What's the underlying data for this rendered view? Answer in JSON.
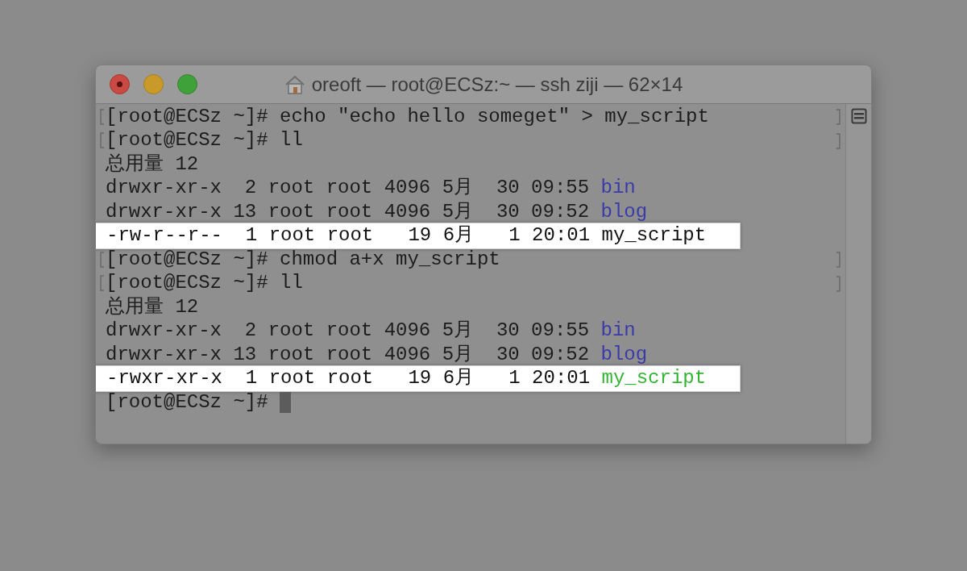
{
  "window": {
    "title": "oreoft — root@ECSz:~ — ssh ziji — 62×14"
  },
  "lines": [
    {
      "kind": "prompt",
      "marked": true,
      "prompt": "[root@ECSz ~]#",
      "command": "echo \"echo hello someget\" > my_script"
    },
    {
      "kind": "prompt",
      "marked": true,
      "prompt": "[root@ECSz ~]#",
      "command": "ll"
    },
    {
      "kind": "output",
      "marked": false,
      "text": "总用量 12"
    },
    {
      "kind": "listing",
      "highlighted": false,
      "text": "drwxr-xr-x  2 root root 4096 5月  30 09:55",
      "file": "bin",
      "color": "#3a3aa8"
    },
    {
      "kind": "listing",
      "highlighted": false,
      "text": "drwxr-xr-x 13 root root 4096 5月  30 09:52",
      "file": "blog",
      "color": "#3a3aa8"
    },
    {
      "kind": "listing",
      "highlighted": true,
      "text": "-rw-r--r--  1 root root   19 6月   1 20:01",
      "file": "my_script",
      "color": "#111111"
    },
    {
      "kind": "prompt",
      "marked": true,
      "prompt": "[root@ECSz ~]#",
      "command": "chmod a+x my_script"
    },
    {
      "kind": "prompt",
      "marked": true,
      "prompt": "[root@ECSz ~]#",
      "command": "ll"
    },
    {
      "kind": "output",
      "marked": false,
      "text": "总用量 12"
    },
    {
      "kind": "listing",
      "highlighted": false,
      "text": "drwxr-xr-x  2 root root 4096 5月  30 09:55",
      "file": "bin",
      "color": "#3a3aa8"
    },
    {
      "kind": "listing",
      "highlighted": false,
      "text": "drwxr-xr-x 13 root root 4096 5月  30 09:52",
      "file": "blog",
      "color": "#3a3aa8"
    },
    {
      "kind": "listing",
      "highlighted": true,
      "text": "-rwxr-xr-x  1 root root   19 6月   1 20:01",
      "file": "my_script",
      "color": "#33b533"
    },
    {
      "kind": "prompt",
      "marked": false,
      "prompt": "[root@ECSz ~]#",
      "cursor": true
    }
  ]
}
